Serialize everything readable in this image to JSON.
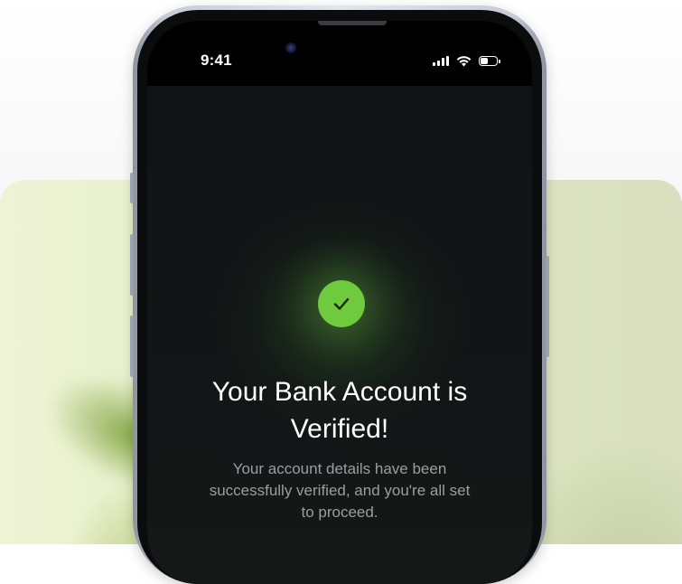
{
  "status_bar": {
    "time": "9:41",
    "icons": [
      "signal-icon",
      "wifi-icon",
      "battery-icon"
    ]
  },
  "verification": {
    "icon": "checkmark-icon",
    "accent_color": "#6fca3e",
    "title_line1": "Your Bank Account is",
    "title_line2": "Verified!",
    "description": "Your account details have been successfully verified, and you're all set to proceed."
  }
}
